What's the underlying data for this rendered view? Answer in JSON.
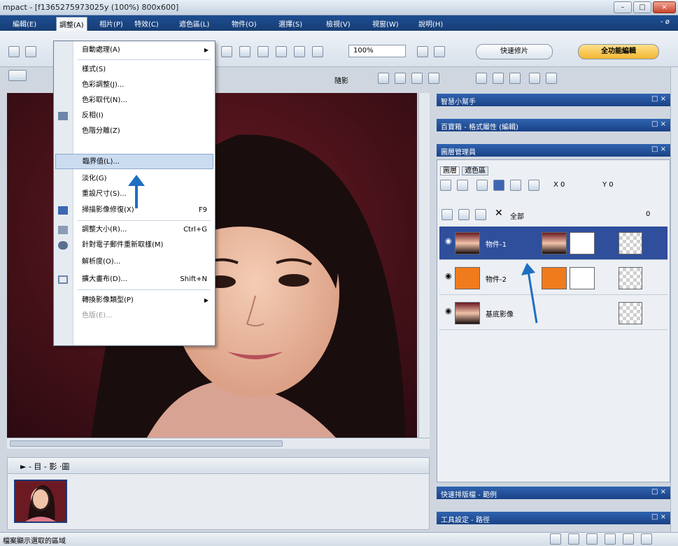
{
  "window": {
    "title": "mpact - [f1365275973025y (100%) 800x600]",
    "buttons": [
      "–",
      "□",
      "×"
    ]
  },
  "menubar": {
    "items": [
      "編輯(E)",
      "調整(A)",
      "相片(P)",
      "特效(C)",
      "遮色區(L)",
      "物件(O)",
      "選擇(S)",
      "檢視(V)",
      "視窗(W)",
      "說明(H)"
    ],
    "active_index": 1,
    "right": "- ø"
  },
  "toolbar": {
    "zoom": "100%",
    "mode_quick": "快速修片",
    "mode_full": "全功能編輯",
    "checkbox_label": "隨影"
  },
  "menu": {
    "items": [
      {
        "label": "自動處理(A)",
        "submenu": true
      },
      {
        "label": "樣式(S)"
      },
      {
        "label": "色彩調整(J)..."
      },
      {
        "label": "色彩取代(N)..."
      },
      {
        "label": "反相(I)"
      },
      {
        "label": "色階分離(Z)"
      },
      {
        "label": "臨界值(L)...",
        "highlighted": true
      },
      {
        "label": "淡化(G)"
      },
      {
        "label": "重設尺寸(S)..."
      },
      {
        "label": "掃描影像修復(X)",
        "shortcut": "F9"
      },
      {
        "label": "調整大小(R)...",
        "shortcut": "Ctrl+G"
      },
      {
        "label": "針對電子郵件重新取樣(M)"
      },
      {
        "label": "解析度(O)..."
      },
      {
        "label": "擴大畫布(D)...",
        "shortcut": "Shift+N"
      },
      {
        "label": "轉換影像類型(P)",
        "submenu": true
      },
      {
        "label": "色版(E)...",
        "disabled": true
      }
    ]
  },
  "panels": {
    "p1": "智慧小幫手",
    "p2": "百寶箱 - 格式屬性 (編輯)",
    "p3": "圖層管理員",
    "p4": "快速排版檔 - 範例",
    "p5": "工具設定 - 路徑",
    "close": "□ ×",
    "layer_tabs": [
      "圖層",
      "遮色區"
    ],
    "x_label": "X 0",
    "y_label": "Y 0",
    "blend": "全部",
    "opacity": "0"
  },
  "layers": [
    {
      "name": "物件-1",
      "selected": true
    },
    {
      "name": "物件-2",
      "selected": false
    },
    {
      "name": "基底影像",
      "selected": false
    }
  ],
  "filmstrip": {
    "controls": "► - 目 - 影 ·圖"
  },
  "status": {
    "text": "檔案顯示選取的區域"
  },
  "colors": {
    "menubar": "#1d4e92",
    "panel_header": "#1a4286",
    "selected_layer": "#2f4f9c",
    "arrow": "#1e6fc2",
    "orange_swatch": "#f07b1d"
  }
}
